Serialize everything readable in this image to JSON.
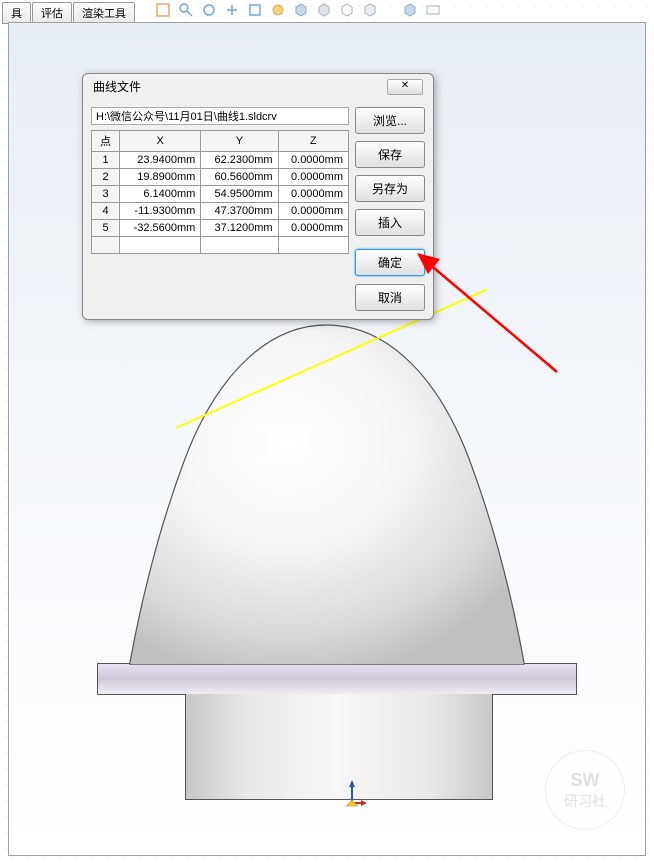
{
  "menu": {
    "tabs": [
      "具",
      "评估",
      "渲染工具"
    ]
  },
  "dialog": {
    "title": "曲线文件",
    "close_symbol": "✕",
    "file_path": "H:\\微信公众号\\11月01日\\曲线1.sldcrv",
    "headers": [
      "点",
      "X",
      "Y",
      "Z"
    ],
    "rows": [
      [
        "1",
        "23.9400mm",
        "62.2300mm",
        "0.0000mm"
      ],
      [
        "2",
        "19.8900mm",
        "60.5600mm",
        "0.0000mm"
      ],
      [
        "3",
        "6.1400mm",
        "54.9500mm",
        "0.0000mm"
      ],
      [
        "4",
        "-11.9300mm",
        "47.3700mm",
        "0.0000mm"
      ],
      [
        "5",
        "-32.5600mm",
        "37.1200mm",
        "0.0000mm"
      ]
    ],
    "buttons": {
      "browse": "浏览...",
      "save": "保存",
      "save_as": "另存为",
      "insert": "插入",
      "ok": "确定",
      "cancel": "取消"
    }
  },
  "watermark": {
    "line1": "SW",
    "line2": "研习社"
  }
}
